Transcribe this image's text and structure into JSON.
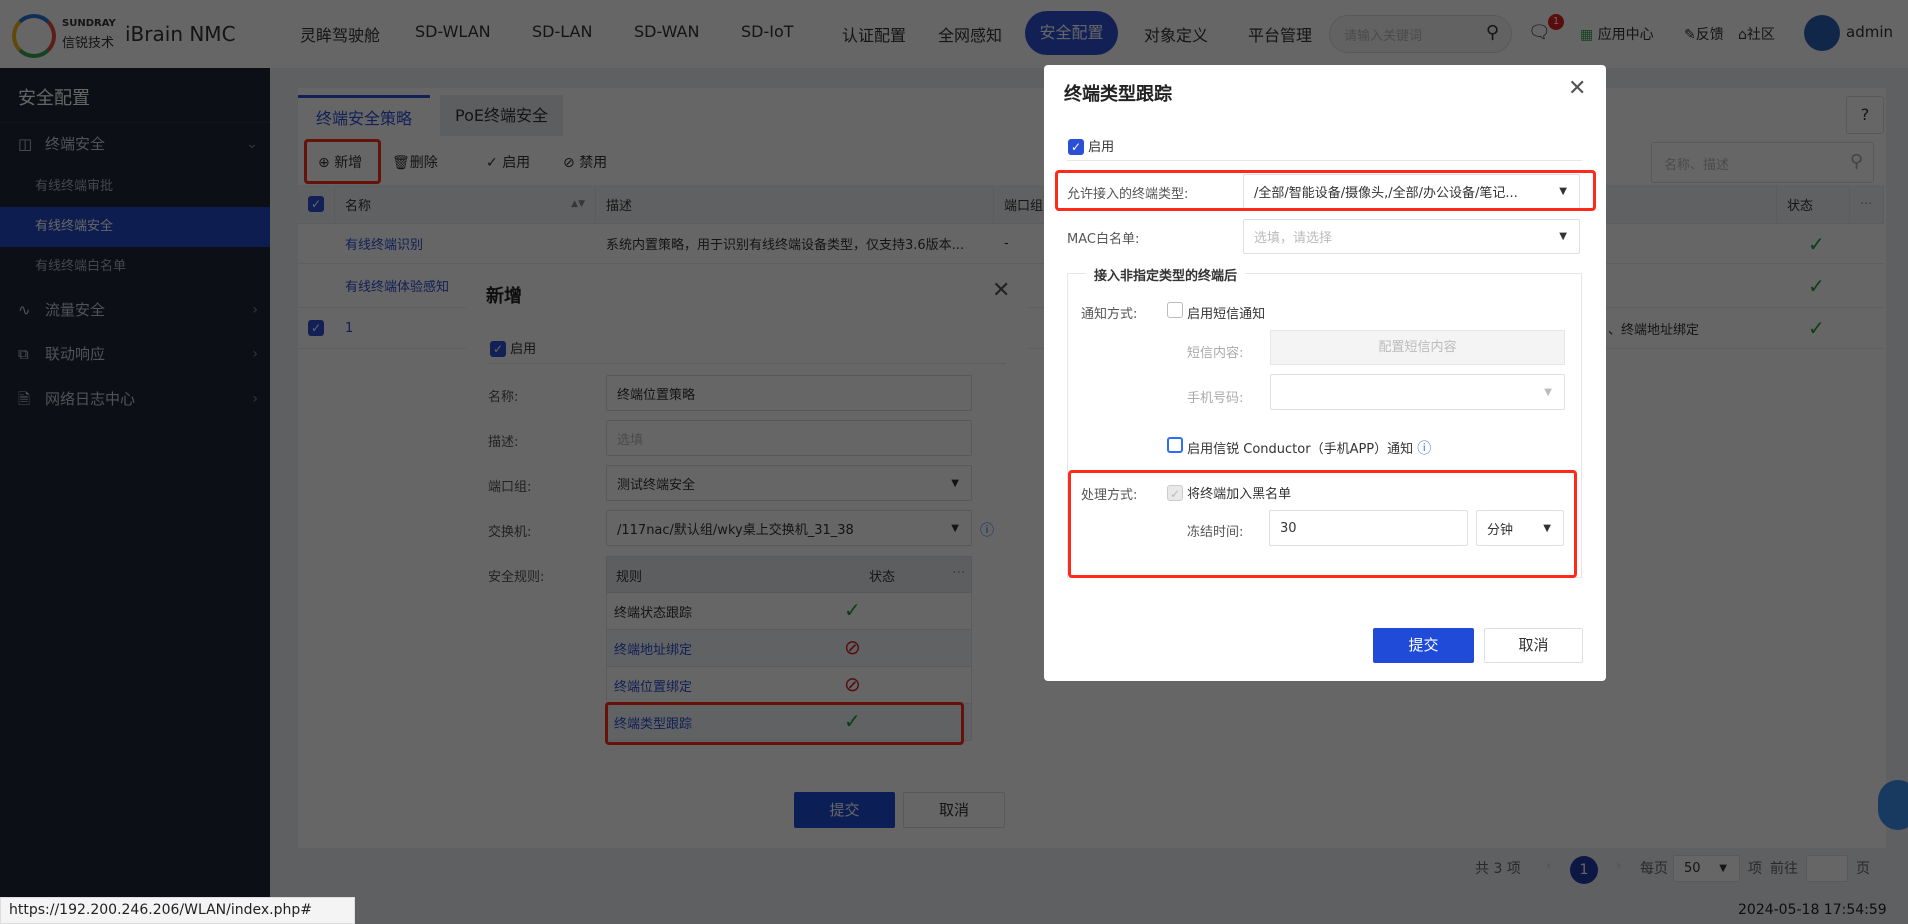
{
  "header": {
    "brand_top": "SUNDRAY",
    "brand_cn": "信锐技术",
    "product": "iBrain NMC",
    "nav": [
      "灵眸驾驶舱",
      "SD-WLAN",
      "SD-LAN",
      "SD-WAN",
      "SD-IoT",
      "认证配置",
      "全网感知",
      "安全配置",
      "对象定义",
      "平台管理"
    ],
    "active_nav": "安全配置",
    "search_placeholder": "请输入关键词",
    "message_badge": "1",
    "app_center": "应用中心",
    "feedback": "反馈",
    "community": "社区",
    "user": "admin"
  },
  "sidebar": {
    "title": "安全配置",
    "groups": [
      {
        "label": "终端安全",
        "icon": "terminal-security-icon",
        "expanded": true,
        "children": [
          "有线终端审批",
          "有线终端安全",
          "有线终端白名单"
        ],
        "active": "有线终端安全"
      },
      {
        "label": "流量安全",
        "icon": "pulse-icon"
      },
      {
        "label": "联动响应",
        "icon": "link-icon"
      },
      {
        "label": "网络日志中心",
        "icon": "log-icon"
      }
    ]
  },
  "main": {
    "tabs": [
      "终端安全策略",
      "PoE终端安全"
    ],
    "active_tab": "终端安全策略",
    "toolbar": {
      "add": "新增",
      "delete": "删除",
      "enable": "启用",
      "disable": "禁用"
    },
    "search_placeholder": "名称、描述",
    "table": {
      "columns": [
        "名称",
        "描述",
        "端口组",
        "状态"
      ],
      "rows": [
        {
          "name": "有线终端识别",
          "desc": "系统内置策略，用于识别有线终端设备类型，仅支持3.6版本...",
          "port_group": "-",
          "extra": "",
          "status": "enabled",
          "checked": false
        },
        {
          "name": "有线终端体验感知",
          "desc": "",
          "port_group": "",
          "extra": "",
          "status": "enabled",
          "checked": false
        },
        {
          "name": "1",
          "desc": "",
          "port_group": "",
          "extra": "、终端地址绑定",
          "status": "enabled",
          "checked": true
        }
      ]
    },
    "pagination": {
      "total": "共 3 项",
      "page": "1",
      "per_page_label": "每页",
      "per_page": "50",
      "item_unit": "项",
      "goto": "前往",
      "page_unit": "页"
    }
  },
  "status_url": "https://192.200.246.206/WLAN/index.php#",
  "datetime": "2024-05-18 17:54:59",
  "add_dialog": {
    "title": "新增",
    "enable_label": "启用",
    "enabled": true,
    "fields": {
      "name_label": "名称:",
      "name_value": "终端位置策略",
      "desc_label": "描述:",
      "desc_placeholder": "选填",
      "port_group_label": "端口组:",
      "port_group_value": "测试终端安全",
      "switch_label": "交换机:",
      "switch_value": "/117nac/默认组/wky桌上交换机_31_38",
      "rules_label": "安全规则:"
    },
    "rules_table": {
      "columns": [
        "规则",
        "状态"
      ],
      "rows": [
        {
          "rule": "终端状态跟踪",
          "status": "enabled"
        },
        {
          "rule": "终端地址绑定",
          "status": "disabled"
        },
        {
          "rule": "终端位置绑定",
          "status": "disabled"
        },
        {
          "rule": "终端类型跟踪",
          "status": "enabled"
        }
      ]
    },
    "submit": "提交",
    "cancel": "取消"
  },
  "type_dialog": {
    "title": "终端类型跟踪",
    "enable_label": "启用",
    "enabled": true,
    "allowed_label": "允许接入的终端类型:",
    "allowed_value": "/全部/智能设备/摄像头,/全部/办公设备/笔记...",
    "mac_label": "MAC白名单:",
    "mac_placeholder": "选填，请选择",
    "section_title": "接入非指定类型的终端后",
    "notify_label": "通知方式:",
    "sms_label": "启用短信通知",
    "sms_enabled": false,
    "sms_content_label": "短信内容:",
    "sms_content_button": "配置短信内容",
    "phone_label": "手机号码:",
    "app_label": "启用信锐 Conductor（手机APP）通知",
    "app_enabled": false,
    "action_label": "处理方式:",
    "blacklist_label": "将终端加入黑名单",
    "blacklist_checked": true,
    "freeze_label": "冻结时间:",
    "freeze_value": "30",
    "freeze_unit": "分钟",
    "submit": "提交",
    "cancel": "取消"
  },
  "colors": {
    "primary": "#2c4fd8",
    "highlight": "#ff2a1a",
    "success": "#1a9b3a",
    "danger": "#d0232a",
    "sidebar": "#1d2637"
  }
}
